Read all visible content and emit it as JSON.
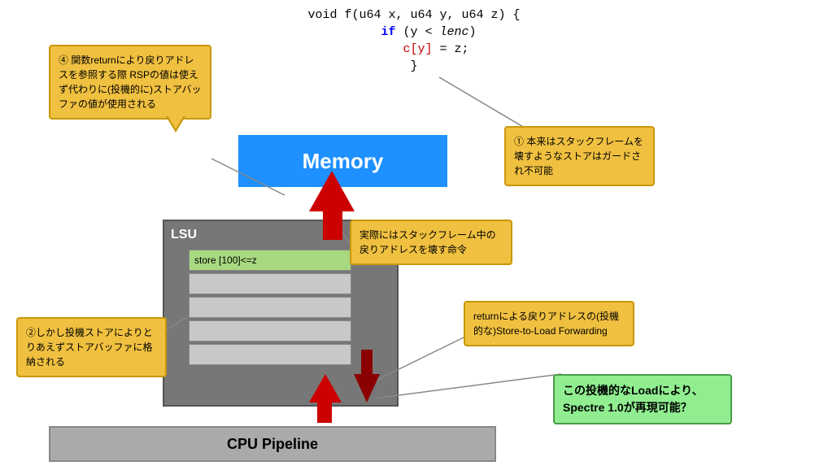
{
  "code": {
    "line1": "void f(u64 x,  u64 y,  u64 z) {",
    "line2_kw": "if",
    "line2_rest": " (y < ",
    "line2_italic": "lenc",
    "line2_end": ")",
    "line3_red": "c[y]",
    "line3_eq": " = z;",
    "line4": "}"
  },
  "memory_label": "Memory",
  "lsu_label": "LSU",
  "store_row_label": "store [100]<=z",
  "cpu_pipeline_label": "CPU Pipeline",
  "callout1": {
    "text": "④ 関数returnにより戻りアドレスを参照する際 RSPの値は使えず代わりに(投機的に)ストアバッファの値が使用される"
  },
  "callout2": {
    "text": "②しかし投機ストアによりとりあえずストアバッファに格納される"
  },
  "callout3": {
    "text": "① 本来はスタックフレームを壊すようなストアはガードされ不可能"
  },
  "callout4": {
    "text": "実際にはスタックフレーム中の戻りアドレスを壊す命令"
  },
  "callout5": {
    "text": "returnによる戻りアドレスの(投機的な)Store-to-Load Forwarding"
  },
  "callout6": {
    "text": "この投機的なLoadにより、Spectre 1.0が再現可能？"
  }
}
